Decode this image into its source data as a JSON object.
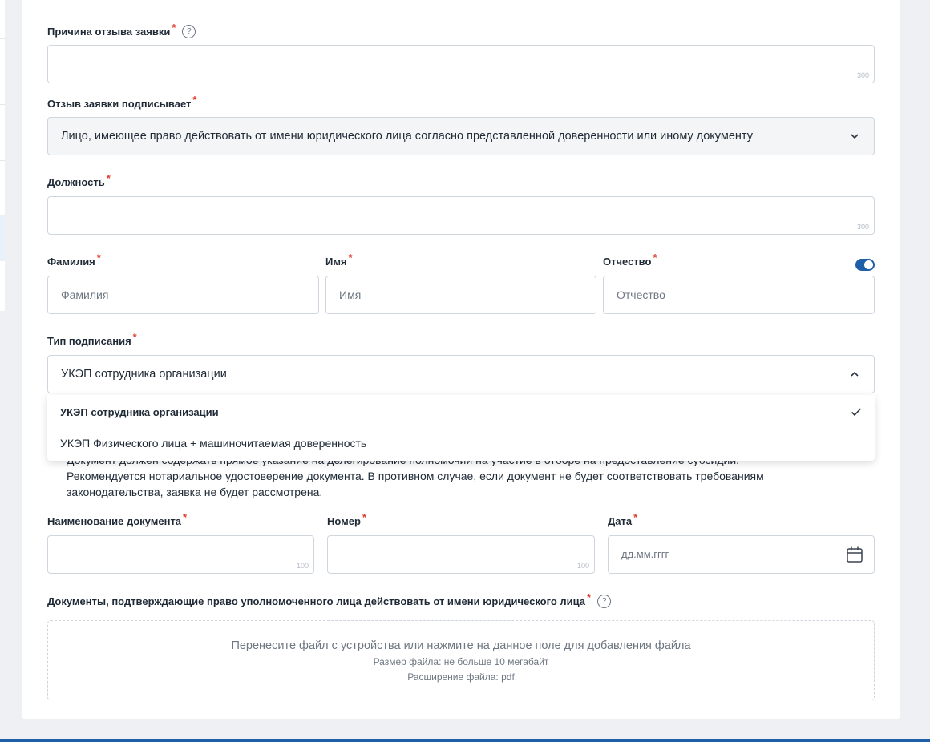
{
  "form": {
    "reason": {
      "label": "Причина отзыва заявки",
      "required_mark": "*",
      "help": "?",
      "counter": "300",
      "value": ""
    },
    "signer": {
      "label": "Отзыв заявки подписывает",
      "required_mark": "*",
      "value": "Лицо, имеющее право действовать от имени юридического лица согласно представленной доверенности или иному документу",
      "icon": "chevron-down-icon"
    },
    "position": {
      "label": "Должность",
      "required_mark": "*",
      "counter": "300",
      "value": ""
    },
    "last_name": {
      "label": "Фамилия",
      "required_mark": "*",
      "placeholder": "Фамилия"
    },
    "first_name": {
      "label": "Имя",
      "required_mark": "*",
      "placeholder": "Имя"
    },
    "middle_name": {
      "label": "Отчество",
      "required_mark": "*",
      "placeholder": "Отчество",
      "toggle_on": true
    },
    "signing_type": {
      "label": "Тип подписания",
      "required_mark": "*",
      "value": "УКЭП сотрудника организации",
      "icon": "chevron-up-icon",
      "options": [
        {
          "label": "УКЭП сотрудника организации",
          "selected": true
        },
        {
          "label": "УКЭП Физического лица + машиночитаемая доверенность",
          "selected": false
        }
      ]
    },
    "notice": [
      "Документ должен содержать прямое указание на делегирование полномочий на участие в отборе на предоставление субсидии.",
      "Рекомендуется нотариальное удостоверение документа. В противном случае, если документ не будет соответствовать требованиям",
      "законодательства, заявка не будет рассмотрена."
    ],
    "doc_name": {
      "label": "Наименование документа",
      "required_mark": "*",
      "counter": "100"
    },
    "doc_number": {
      "label": "Номер",
      "required_mark": "*",
      "counter": "100"
    },
    "doc_date": {
      "label": "Дата",
      "required_mark": "*",
      "placeholder": "дд.мм.гггг",
      "icon": "calendar-icon"
    },
    "documents": {
      "label": "Документы, подтверждающие право уполномоченного лица действовать от имени юридического лица",
      "required_mark": "*",
      "help": "?",
      "drop_text": "Перенесите файл с устройства или нажмите на данное поле для добавления файла",
      "size_text": "Размер файла: не больше 10 мегабайт",
      "ext_text": "Расширение файла: pdf"
    }
  },
  "colors": {
    "accent": "#1f5fa8",
    "required": "#e03b2a",
    "border": "#cfd6de",
    "muted": "#6e7782"
  }
}
